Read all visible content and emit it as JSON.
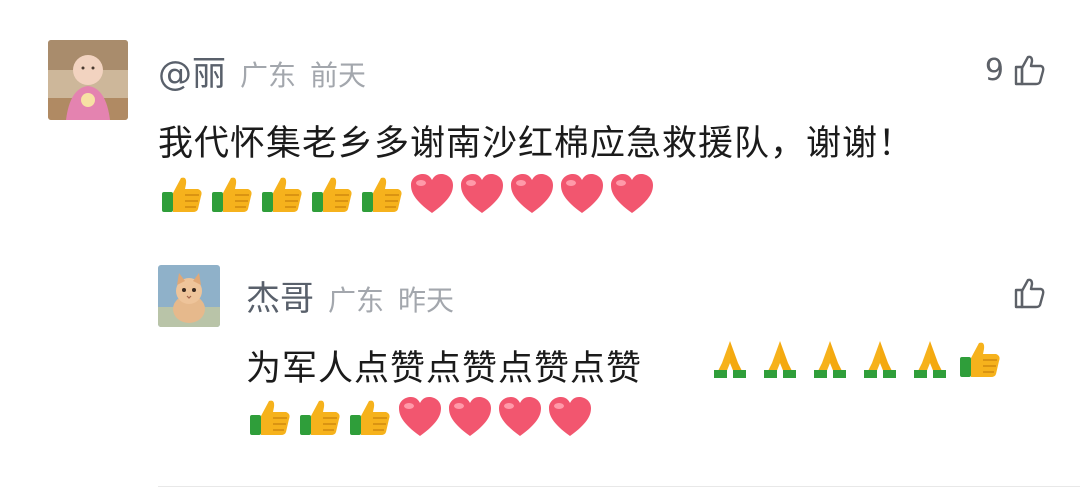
{
  "comments": [
    {
      "author": "@丽",
      "location": "广东",
      "time": "前天",
      "like_count": "9",
      "text": "我代怀集老乡多谢南沙红棉应急救援队，谢谢！",
      "emojis": [
        "thumbs-up",
        "thumbs-up",
        "thumbs-up",
        "thumbs-up",
        "thumbs-up",
        "heart",
        "heart",
        "heart",
        "heart",
        "heart"
      ]
    }
  ],
  "reply": {
    "author": "杰哥",
    "location": "广东",
    "time": "昨天",
    "like_count": "",
    "text": "为军人点赞点赞点赞点赞",
    "emojis_inline": [
      "folded-hands",
      "folded-hands",
      "folded-hands",
      "folded-hands",
      "folded-hands",
      "thumbs-up"
    ],
    "emojis_next_line": [
      "thumbs-up",
      "thumbs-up",
      "thumbs-up",
      "heart",
      "heart",
      "heart",
      "heart"
    ]
  },
  "colors": {
    "author": "#59606b",
    "meta": "#a3a7ad",
    "heart": "#f2566f",
    "thumb": "#f6b21c",
    "sleeve": "#2f9e3a"
  }
}
